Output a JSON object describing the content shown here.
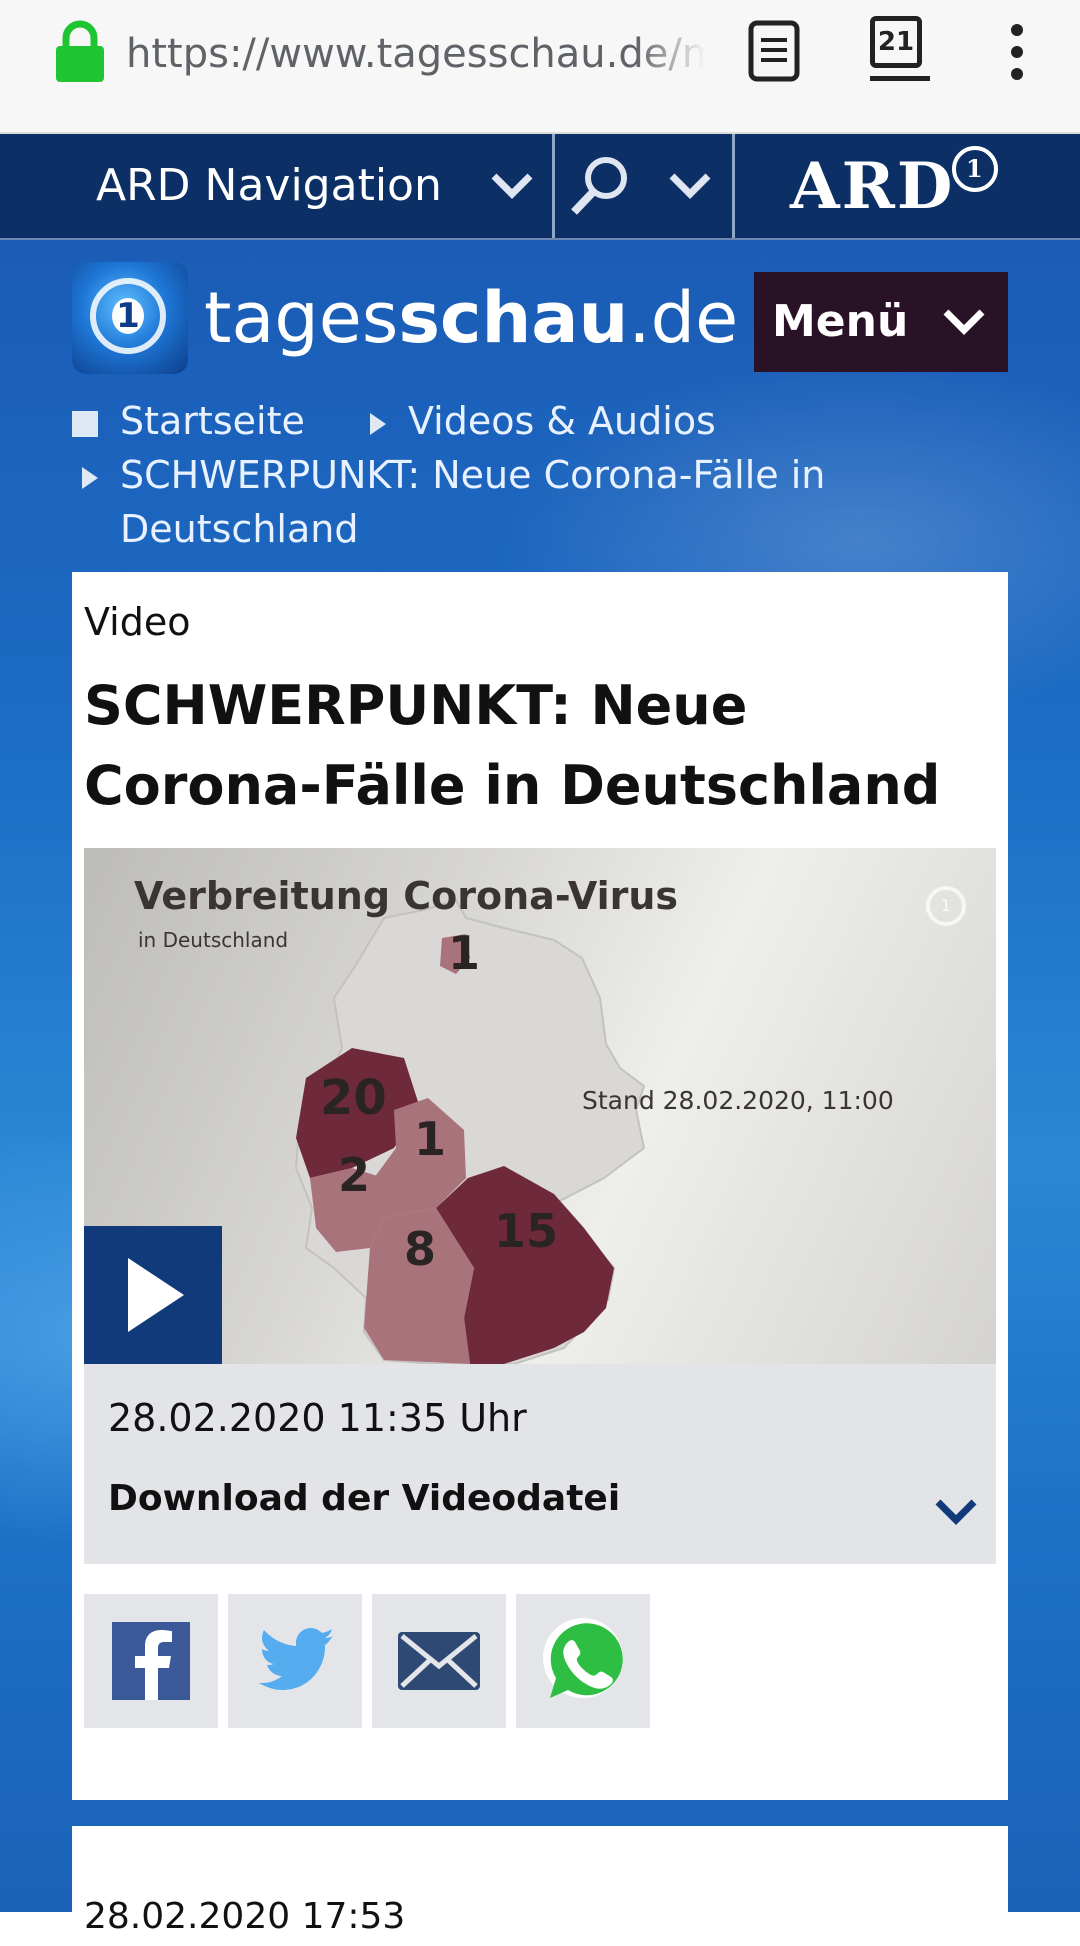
{
  "browser": {
    "url": "https://www.tagesschau.de/multimedia",
    "tab_count": "21"
  },
  "ard_nav": {
    "label": "ARD Navigation",
    "logo_text": "ARD",
    "logo_mark": "1"
  },
  "site": {
    "logo_mark": "1",
    "wordmark_prefix": "tages",
    "wordmark_bold": "schau",
    "wordmark_suffix": ".de",
    "menu_label": "Menü"
  },
  "breadcrumb": [
    {
      "label": "Startseite"
    },
    {
      "label": "Videos & Audios"
    },
    {
      "label": "SCHWERPUNKT: Neue Corona-Fälle in"
    },
    {
      "label": "Deutschland"
    }
  ],
  "article": {
    "kicker": "Video",
    "title": "SCHWERPUNKT: Neue Corona-Fälle in Deutschland",
    "video": {
      "title": "Verbreitung Corona-Virus",
      "subtitle": "in Deutschland",
      "stand": "Stand 28.02.2020, 11:00",
      "hd_mark": "1",
      "map_numbers": [
        "1",
        "20",
        "1",
        "2",
        "8",
        "15"
      ]
    },
    "date": "28.02.2020 11:35 Uhr",
    "download_label": "Download der Videodatei",
    "share": [
      "facebook",
      "twitter",
      "email",
      "whatsapp"
    ]
  },
  "next_item": {
    "timestamp": "28.02.2020 17:53"
  },
  "colors": {
    "nav_bg": "#0c2f66",
    "menu_bg": "#2a1226",
    "play_bg": "#113a7a",
    "region_dark": "#6e2a3a",
    "region_light": "#a9737c"
  }
}
